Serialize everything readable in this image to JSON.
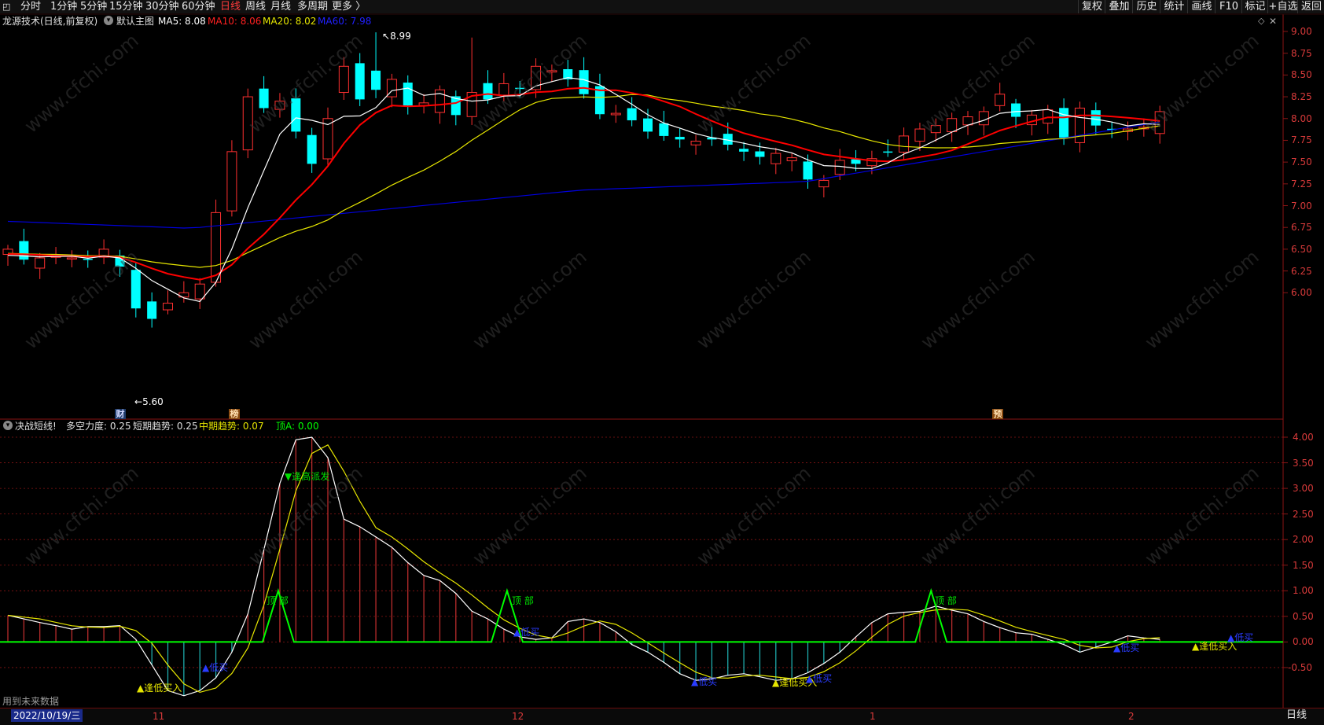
{
  "toolbar": {
    "left": [
      "分时",
      "1分钟",
      "5分钟",
      "15分钟",
      "30分钟",
      "60分钟",
      "日线",
      "周线",
      "月线",
      "多周期",
      "更多 〉"
    ],
    "active": "日线",
    "right": [
      "复权",
      "叠加",
      "历史",
      "统计",
      "画线",
      "F10",
      "标记",
      "+自选",
      "返回"
    ]
  },
  "main_panel": {
    "title": "龙源技术(日线,前复权)",
    "indicator": "默认主图",
    "ma5": "MA5: 8.08",
    "ma10": "MA10: 8.06",
    "ma20": "MA20: 8.02",
    "ma60": "MA60: 7.98",
    "high_label": "8.99",
    "low_label": "5.60",
    "markers": [
      "财",
      "榜",
      "预"
    ]
  },
  "sub_panel": {
    "title": "决战短线!",
    "f1": "多空力度: 0.25",
    "f2": "短期趋势: 0.25",
    "f3": "中期趋势: 0.07",
    "f4": "顶A: 0.00",
    "future_note": "用到未来数据"
  },
  "annotations": {
    "buy_low": "逢低买入",
    "sell_high": "逢高派发",
    "top": "顶 部",
    "low_buy": "低买"
  },
  "price_axis": [
    "9.00",
    "8.75",
    "8.50",
    "8.25",
    "8.00",
    "7.75",
    "7.50",
    "7.25",
    "7.00",
    "6.75",
    "6.50",
    "6.25",
    "6.00"
  ],
  "osc_axis": [
    "4.00",
    "3.50",
    "3.00",
    "2.50",
    "2.00",
    "1.50",
    "1.00",
    "0.50",
    "0.00",
    "-0.50"
  ],
  "date_bar": {
    "current_date": "2022/10/19/三",
    "months": [
      "11",
      "12",
      "1",
      "2"
    ],
    "period_button": "日线"
  },
  "colors": {
    "up": "#ff3030",
    "down": "#00ffff",
    "ma5": "#ffffff",
    "ma10": "#ff0000",
    "ma20": "#e6e600",
    "ma60": "#0000e0",
    "grid": "#8a1515",
    "top_line": "#00ff00"
  },
  "icons": [
    "collapse-icon",
    "panel-toggle-icon",
    "window-restore-icon",
    "window-close-icon"
  ]
}
